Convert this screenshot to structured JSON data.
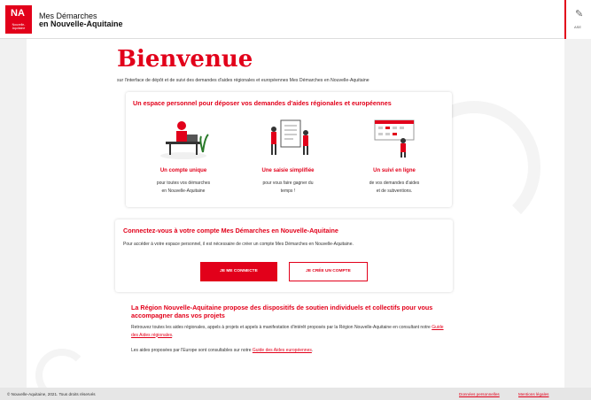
{
  "header": {
    "logo_mark": "NA",
    "logo_text": "Nouvelle-Aquitaine",
    "title_line1": "Mes Démarches",
    "title_line2": "en Nouvelle-Aquitaine",
    "accessibility_label": "ASE"
  },
  "main": {
    "welcome_title": "Bienvenue",
    "welcome_sub": "sur l'interface de dépôt et de suivi des demandes d'aides régionales et européennes Mes Démarches en Nouvelle-Aquitaine",
    "space_card": {
      "title": "Un espace personnel pour déposer vos demandes d'aides régionales et européennes",
      "features": [
        {
          "title": "Un compte unique",
          "line1": "pour toutes vos démarches",
          "line2": "en Nouvelle-Aquitaine"
        },
        {
          "title": "Une saisie simplifiée",
          "line1": "pour vous faire gagner du",
          "line2": "temps !"
        },
        {
          "title": "Un suivi en ligne",
          "line1": "de vos demandes d'aides",
          "line2": "et de subventions."
        }
      ]
    },
    "connect_card": {
      "title": "Connectez-vous à votre compte Mes Démarches en Nouvelle-Aquitaine",
      "description": "Pour accéder à votre espace personnel, il est nécessaire de créer un compte Mes Démarches en Nouvelle-Aquitaine.",
      "login_button": "JE ME CONNECTE",
      "create_button": "JE CRÉE UN COMPTE"
    },
    "region": {
      "title": "La Région Nouvelle-Aquitaine propose des dispositifs de soutien individuels et collectifs pour vous accompagner dans vos projets",
      "text1": "Retrouvez toutes les aides régionales, appels à projets et appels à manifestation d'intérêt proposés par la Région Nouvelle-Aquitaine en consultant notre",
      "link1": "Guide des Aides régionales",
      "text1_end": ".",
      "text2": "Les aides proposées par l'Europe sont consultables sur notre",
      "link2": "Guide des Aides européennes",
      "text2_end": "."
    }
  },
  "footer": {
    "copyright": "© Nouvelle-Aquitaine, 2021. Tous droits réservés",
    "link_data": "Données personnelles",
    "link_legal": "Mentions légales"
  },
  "colors": {
    "brand": "#e2001a",
    "background": "#f1f1f1"
  },
  "icons": [
    "logo-icon",
    "accessibility-icon"
  ]
}
